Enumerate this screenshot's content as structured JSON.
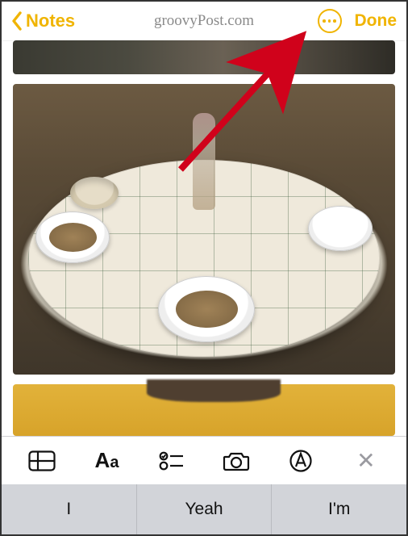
{
  "colors": {
    "accent": "#f0b400",
    "muted": "#8a8a8a"
  },
  "header": {
    "back_label": "Notes",
    "url_text": "groovyPost.com",
    "done_label": "Done"
  },
  "toolbar": {
    "items": [
      {
        "name": "table-icon"
      },
      {
        "name": "text-format-icon"
      },
      {
        "name": "checklist-icon"
      },
      {
        "name": "camera-icon"
      },
      {
        "name": "markup-icon"
      },
      {
        "name": "close-toolbar-icon"
      }
    ],
    "aa_label_big": "A",
    "aa_label_small": "a"
  },
  "suggestions": [
    "I",
    "Yeah",
    "I'm"
  ],
  "annotation": {
    "arrow_target": "more-options-button"
  }
}
